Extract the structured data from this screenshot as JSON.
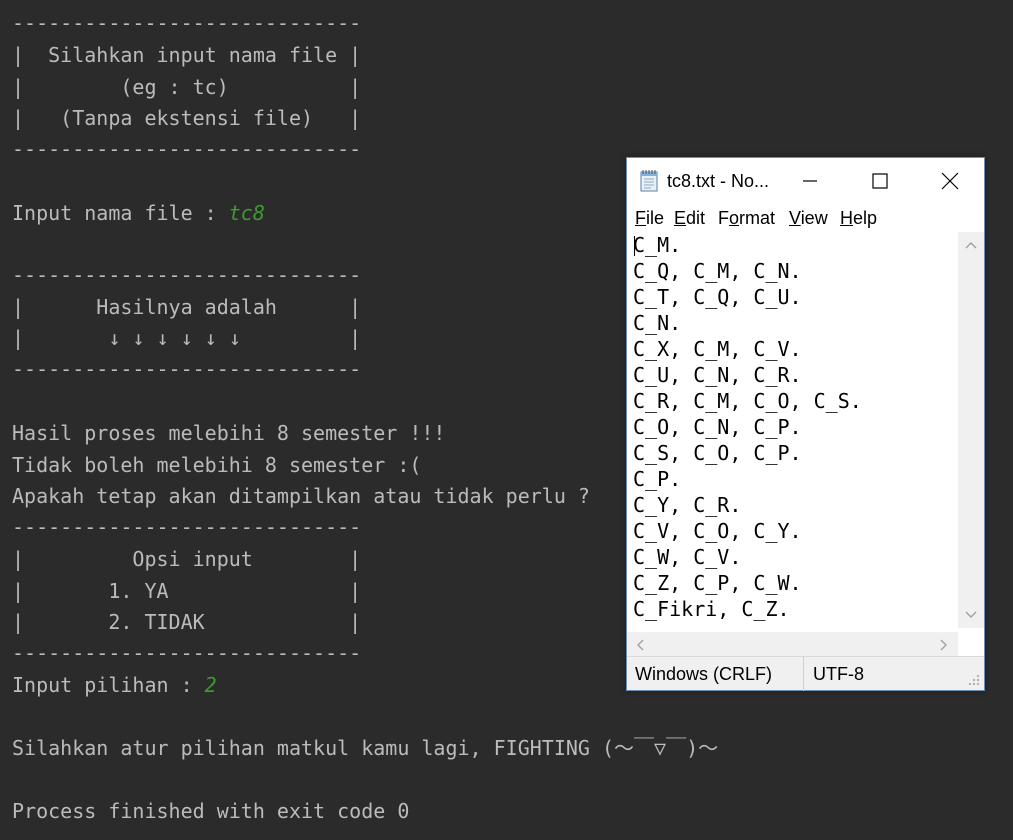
{
  "console": {
    "lines": [
      "-----------------------------",
      "|  Silahkan input nama file |",
      "|        (eg : tc)          |",
      "|   (Tanpa ekstensi file)   |",
      "-----------------------------",
      "Input nama file : ",
      "-----------------------------",
      "|      Hasilnya adalah      |",
      "|       ↓ ↓ ↓ ↓ ↓ ↓         |",
      "-----------------------------",
      "Hasil proses melebihi 8 semester !!!",
      "Tidak boleh melebihi 8 semester :(",
      "Apakah tetap akan ditampilkan atau tidak perlu ?",
      "-----------------------------",
      "|         Opsi input        |",
      "|       1. YA               |",
      "|       2. TIDAK            |",
      "-----------------------------",
      "Input pilihan : ",
      "Silahkan atur pilihan matkul kamu lagi, FIGHTING (～￣▽￣)～",
      "Process finished with exit code 0"
    ],
    "filename_input": "tc8",
    "choice_input": "2"
  },
  "notepad": {
    "title": "tc8.txt - No...",
    "menu": [
      {
        "key": "F",
        "rest": "ile"
      },
      {
        "key": "E",
        "rest": "dit"
      },
      {
        "key": "o",
        "pre": "F",
        "rest": "rmat"
      },
      {
        "key": "V",
        "rest": "iew"
      },
      {
        "key": "H",
        "rest": "elp"
      }
    ],
    "lines": [
      "C_M.",
      "C_Q, C_M, C_N.",
      "C_T, C_Q, C_U.",
      "C_N.",
      "C_X, C_M, C_V.",
      "C_U, C_N, C_R.",
      "C_R, C_M, C_O, C_S.",
      "C_O, C_N, C_P.",
      "C_S, C_O, C_P.",
      "C_P.",
      "C_Y, C_R.",
      "C_V, C_O, C_Y.",
      "C_W, C_V.",
      "C_Z, C_P, C_W.",
      "C_Fikri, C_Z."
    ],
    "status": {
      "line_ending": "Windows (CRLF)",
      "encoding": "UTF-8"
    }
  },
  "colors": {
    "console_bg": "#2b2b2b",
    "console_text": "#bbbbbb",
    "user_input": "#3d9a2f"
  }
}
